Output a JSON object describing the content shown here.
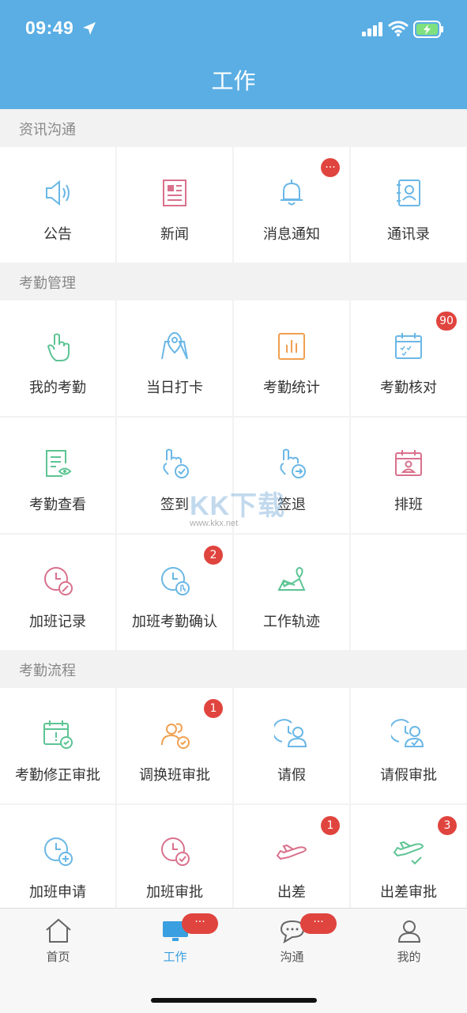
{
  "status_bar": {
    "time": "09:49"
  },
  "header": {
    "title": "工作"
  },
  "sections": [
    {
      "title": "资讯沟通"
    },
    {
      "title": "考勤管理"
    },
    {
      "title": "考勤流程"
    }
  ],
  "tiles": {
    "announcement": {
      "label": "公告",
      "icon": "speaker-icon"
    },
    "news": {
      "label": "新闻",
      "icon": "newspaper-icon"
    },
    "notifications": {
      "label": "消息通知",
      "icon": "bell-icon",
      "badge": "···"
    },
    "contacts": {
      "label": "通讯录",
      "icon": "contacts-book-icon"
    },
    "my_attendance": {
      "label": "我的考勤",
      "icon": "tap-hand-icon"
    },
    "daily_checkin": {
      "label": "当日打卡",
      "icon": "map-pin-icon"
    },
    "attendance_stats": {
      "label": "考勤统计",
      "icon": "bar-chart-icon"
    },
    "attendance_verify": {
      "label": "考勤核对",
      "icon": "calendar-check-icon",
      "badge": "90"
    },
    "attendance_view": {
      "label": "考勤查看",
      "icon": "document-eye-icon"
    },
    "sign_in": {
      "label": "签到",
      "icon": "tap-check-icon"
    },
    "sign_out": {
      "label": "签退",
      "icon": "tap-arrow-icon"
    },
    "shift_schedule": {
      "label": "排班",
      "icon": "calendar-person-icon"
    },
    "overtime_record": {
      "label": "加班记录",
      "icon": "clock-pen-icon"
    },
    "overtime_confirm": {
      "label": "加班考勤确认",
      "icon": "clock-hand-icon",
      "badge": "2"
    },
    "work_track": {
      "label": "工作轨迹",
      "icon": "route-map-icon"
    },
    "correction_approval": {
      "label": "考勤修正审批",
      "icon": "calendar-alert-icon"
    },
    "shift_swap_approval": {
      "label": "调换班审批",
      "icon": "people-check-icon",
      "badge": "1"
    },
    "leave": {
      "label": "请假",
      "icon": "clock-person-icon"
    },
    "leave_approval": {
      "label": "请假审批",
      "icon": "clock-person-check-icon"
    },
    "overtime_apply": {
      "label": "加班申请",
      "icon": "clock-plus-icon"
    },
    "overtime_approval": {
      "label": "加班审批",
      "icon": "clock-check-icon"
    },
    "business_trip": {
      "label": "出差",
      "icon": "airplane-icon",
      "badge": "1"
    },
    "trip_approval": {
      "label": "出差审批",
      "icon": "airplane-check-icon",
      "badge": "3"
    }
  },
  "watermark": {
    "text": "KK下载",
    "url": "www.kkx.net"
  },
  "tabbar": {
    "home": {
      "label": "首页",
      "icon": "home-icon"
    },
    "work": {
      "label": "工作",
      "icon": "monitor-icon",
      "badge": "···"
    },
    "chat": {
      "label": "沟通",
      "icon": "chat-bubble-icon",
      "badge": "···"
    },
    "mine": {
      "label": "我的",
      "icon": "user-icon"
    }
  },
  "colors": {
    "header": "#5aaee4",
    "badge": "#e0443e",
    "active_tab": "#3a9fe0"
  }
}
